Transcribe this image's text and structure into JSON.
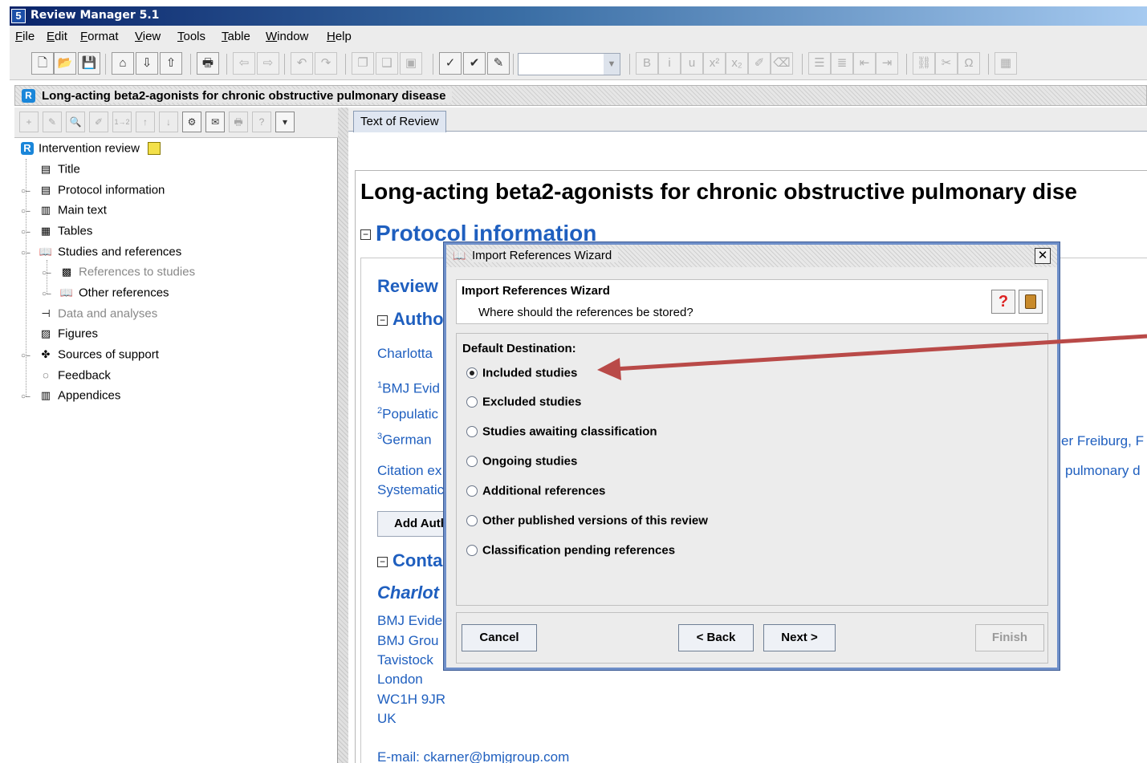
{
  "app": {
    "title": "Review Manager 5.1",
    "icon_name": "revman-5-icon"
  },
  "menubar": [
    {
      "label": "File"
    },
    {
      "label": "Edit"
    },
    {
      "label": "Format"
    },
    {
      "label": "View"
    },
    {
      "label": "Tools"
    },
    {
      "label": "Table"
    },
    {
      "label": "Window"
    },
    {
      "label": "Help"
    }
  ],
  "toolbar": {
    "buttons": [
      {
        "name": "new-file-icon",
        "glyph": "🗋",
        "enabled": true
      },
      {
        "name": "open-folder-icon",
        "glyph": "📂",
        "enabled": true
      },
      {
        "name": "save-icon",
        "glyph": "💾",
        "enabled": true
      },
      {
        "name": "home-icon",
        "glyph": "⌂",
        "enabled": true
      },
      {
        "name": "download-icon",
        "glyph": "⇩",
        "enabled": true
      },
      {
        "name": "upload-icon",
        "glyph": "⇧",
        "enabled": true
      },
      {
        "name": "print-icon",
        "glyph": "🖶",
        "enabled": true
      },
      {
        "name": "back-icon",
        "glyph": "⇦",
        "enabled": false
      },
      {
        "name": "forward-icon",
        "glyph": "⇨",
        "enabled": false
      },
      {
        "name": "undo-icon",
        "glyph": "↶",
        "enabled": false
      },
      {
        "name": "redo-icon",
        "glyph": "↷",
        "enabled": false
      },
      {
        "name": "copy-icon",
        "glyph": "❐",
        "enabled": false
      },
      {
        "name": "paste-icon",
        "glyph": "❑",
        "enabled": false
      },
      {
        "name": "clipboard-icon",
        "glyph": "▣",
        "enabled": false
      },
      {
        "name": "validate-icon",
        "glyph": "✓",
        "enabled": true
      },
      {
        "name": "spellcheck-icon",
        "glyph": "✔",
        "enabled": true
      },
      {
        "name": "format-icon",
        "glyph": "✎",
        "enabled": true
      },
      {
        "name": "bold-icon",
        "glyph": "B",
        "enabled": false
      },
      {
        "name": "italic-icon",
        "glyph": "i",
        "enabled": false
      },
      {
        "name": "underline-icon",
        "glyph": "u",
        "enabled": false
      },
      {
        "name": "superscript-icon",
        "glyph": "x²",
        "enabled": false
      },
      {
        "name": "subscript-icon",
        "glyph": "x₂",
        "enabled": false
      },
      {
        "name": "highlight-icon",
        "glyph": "✐",
        "enabled": false
      },
      {
        "name": "clear-format-icon",
        "glyph": "⌫",
        "enabled": false
      },
      {
        "name": "bullet-list-icon",
        "glyph": "☰",
        "enabled": false
      },
      {
        "name": "numbered-list-icon",
        "glyph": "≣",
        "enabled": false
      },
      {
        "name": "outdent-icon",
        "glyph": "⇤",
        "enabled": false
      },
      {
        "name": "indent-icon",
        "glyph": "⇥",
        "enabled": false
      },
      {
        "name": "link-icon",
        "glyph": "⛓",
        "enabled": false
      },
      {
        "name": "unlink-icon",
        "glyph": "✂",
        "enabled": false
      },
      {
        "name": "symbol-icon",
        "glyph": "Ω",
        "enabled": false
      },
      {
        "name": "table-icon",
        "glyph": "▦",
        "enabled": false
      }
    ],
    "font_combo_value": ""
  },
  "document": {
    "title": "Long-acting beta2-agonists for chronic obstructive pulmonary disease"
  },
  "left_toolbar": {
    "buttons": [
      {
        "name": "add-icon",
        "glyph": "+"
      },
      {
        "name": "edit-icon",
        "glyph": "✎"
      },
      {
        "name": "properties-icon",
        "glyph": "🔍"
      },
      {
        "name": "rename-icon",
        "glyph": "✐"
      },
      {
        "name": "renumber-icon",
        "glyph": "1→2"
      },
      {
        "name": "move-up-icon",
        "glyph": "↑"
      },
      {
        "name": "move-down-icon",
        "glyph": "↓"
      },
      {
        "name": "settings-icon",
        "glyph": "⚙",
        "enabled": true
      },
      {
        "name": "note-icon",
        "glyph": "✉",
        "enabled": true
      },
      {
        "name": "print-outline-icon",
        "glyph": "🖶"
      },
      {
        "name": "help-icon",
        "glyph": "?"
      },
      {
        "name": "dropdown-icon",
        "glyph": "▾",
        "enabled": true
      }
    ]
  },
  "tree": {
    "root": {
      "label": "Intervention review"
    },
    "items": [
      {
        "label": "Title",
        "icon": "page-icon",
        "glyph": "▤",
        "expandable": false,
        "dim": false
      },
      {
        "label": "Protocol information",
        "icon": "document-icon",
        "glyph": "▤",
        "expandable": true,
        "dim": false
      },
      {
        "label": "Main text",
        "icon": "pages-icon",
        "glyph": "▥",
        "expandable": true,
        "dim": false
      },
      {
        "label": "Tables",
        "icon": "table-icon",
        "glyph": "▦",
        "expandable": true,
        "dim": false
      },
      {
        "label": "Studies and references",
        "icon": "book-icon",
        "glyph": "📖",
        "expandable": true,
        "dim": false
      },
      {
        "label": "References to studies",
        "icon": "studies-icon",
        "glyph": "▩",
        "expandable": true,
        "dim": true
      },
      {
        "label": "Other references",
        "icon": "book-icon",
        "glyph": "📖",
        "expandable": true,
        "dim": false
      },
      {
        "label": "Data and analyses",
        "icon": "data-analyses-icon",
        "glyph": "⊣",
        "expandable": false,
        "dim": true
      },
      {
        "label": "Figures",
        "icon": "image-icon",
        "glyph": "▨",
        "expandable": false,
        "dim": false
      },
      {
        "label": "Sources of support",
        "icon": "support-icon",
        "glyph": "✤",
        "expandable": true,
        "dim": false
      },
      {
        "label": "Feedback",
        "icon": "feedback-icon",
        "glyph": "◌",
        "expandable": false,
        "dim": false
      },
      {
        "label": "Appendices",
        "icon": "pages-icon",
        "glyph": "▥",
        "expandable": true,
        "dim": false
      }
    ]
  },
  "editor": {
    "tab_label": "Text of Review",
    "heading": "Long-acting beta2-agonists for chronic obstructive pulmonary dise",
    "protocol_heading": "Protocol information",
    "review_heading": "Review",
    "authors_heading": "Autho",
    "contact_heading": "Conta",
    "author_line": "Charlotta",
    "affil_1_sup": "1",
    "affil_1": "BMJ Evid",
    "affil_2_sup": "2",
    "affil_2": "Populatic",
    "affil_3_sup": "3",
    "affil_3": "German",
    "affil_3_right": "er Freiburg, F",
    "citation_1": "Citation ex",
    "citation_2": "Systematic",
    "citation_right": "pulmonary d",
    "add_author_label": "Add Auth",
    "contact_name": "Charlot",
    "contact_lines": [
      "BMJ Evide",
      "BMJ Grou",
      "Tavistock",
      "London",
      "WC1H 9JR",
      "UK"
    ],
    "email_line": "E-mail: ckarner@bmjgroup.com"
  },
  "dialog": {
    "title": "Import References Wizard",
    "header_title": "Import References Wizard",
    "header_subtitle": "Where should the references be stored?",
    "help_glyph": "?",
    "destination_label": "Default Destination:",
    "options": [
      {
        "label": "Included studies",
        "checked": true
      },
      {
        "label": "Excluded studies",
        "checked": false
      },
      {
        "label": "Studies awaiting classification",
        "checked": false
      },
      {
        "label": "Ongoing studies",
        "checked": false
      },
      {
        "label": "Additional references",
        "checked": false
      },
      {
        "label": "Other published versions of this review",
        "checked": false
      },
      {
        "label": "Classification pending references",
        "checked": false
      }
    ],
    "buttons": {
      "cancel": "Cancel",
      "back": "< Back",
      "next": "Next >",
      "finish": "Finish"
    },
    "close_glyph": "✕"
  },
  "annotation": {
    "arrow_color": "#b94a48"
  }
}
